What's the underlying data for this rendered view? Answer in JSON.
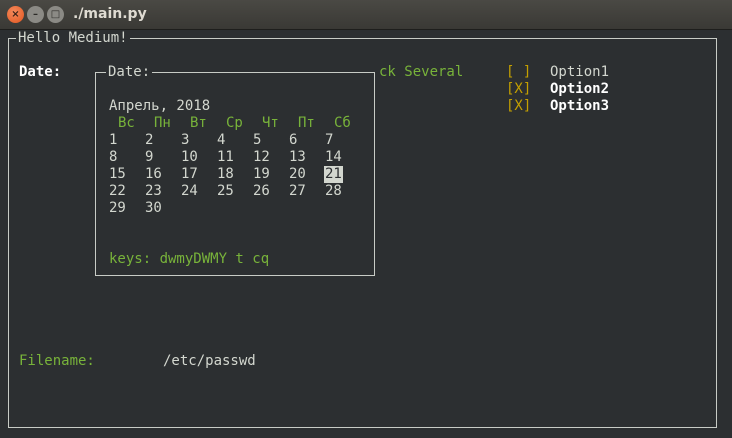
{
  "window": {
    "title": "./main.py",
    "buttons": {
      "close": "×",
      "minimize": "–",
      "maximize": "□"
    }
  },
  "form": {
    "title": "Hello Medium!",
    "date_label": "Date:",
    "pick_label_partial": "ck Several",
    "filename_label": "Filename:",
    "filename_value": "/etc/passwd"
  },
  "options": [
    {
      "mark": "[ ]",
      "label": "Option1",
      "checked": false
    },
    {
      "mark": "[X]",
      "label": "Option2",
      "checked": true
    },
    {
      "mark": "[X]",
      "label": "Option3",
      "checked": true
    }
  ],
  "calendar": {
    "title": "Date:",
    "month_year": "Апрель, 2018",
    "weekdays": [
      "Вс",
      "Пн",
      "Вт",
      "Ср",
      "Чт",
      "Пт",
      "Сб"
    ],
    "weeks": [
      [
        "1",
        "2",
        "3",
        "4",
        "5",
        "6",
        "7"
      ],
      [
        "8",
        "9",
        "10",
        "11",
        "12",
        "13",
        "14"
      ],
      [
        "15",
        "16",
        "17",
        "18",
        "19",
        "20",
        "21"
      ],
      [
        "22",
        "23",
        "24",
        "25",
        "26",
        "27",
        "28"
      ],
      [
        "29",
        "30"
      ]
    ],
    "selected_day": "21",
    "keys_hint": "keys: dwmyDWMY t cq"
  },
  "colors": {
    "background": "#2c2f31",
    "text": "#d3d7cf",
    "label_green": "#78b33a",
    "checkbox_yellow": "#c4a000",
    "selected_bg": "#d3d7cf"
  }
}
